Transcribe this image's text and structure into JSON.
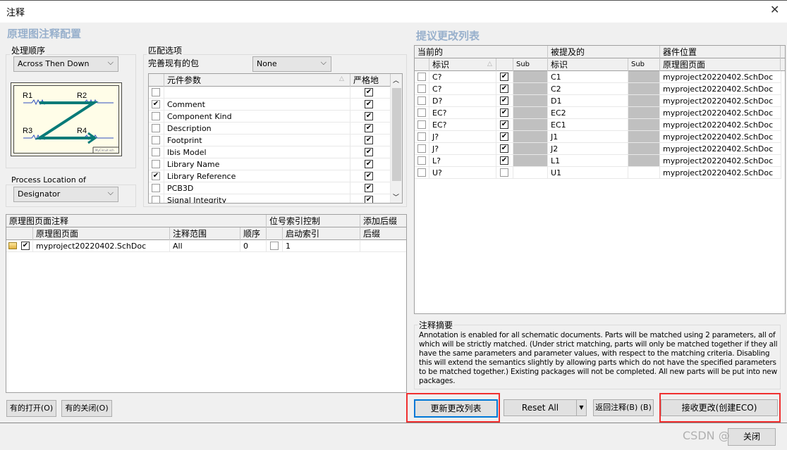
{
  "window": {
    "title": "注释",
    "close_icon": "close-icon"
  },
  "left": {
    "heading": "原理图注释配置",
    "order_group": {
      "label": "处理顺序",
      "value": "Across Then Down",
      "diagram": {
        "labels": [
          "R1",
          "R2",
          "R3",
          "R4"
        ],
        "caption": "MyCircuit.sch"
      }
    },
    "location_group": {
      "label": "Process Location of",
      "value": "Designator"
    },
    "match_group": {
      "label": "匹配选项",
      "complete_label": "完善现有的包",
      "complete_value": "None",
      "columns": {
        "param": "元件参数",
        "strict": "严格地"
      },
      "params": [
        {
          "name": "",
          "checked": false,
          "strict": true
        },
        {
          "name": "Comment",
          "checked": true,
          "strict": true
        },
        {
          "name": "Component Kind",
          "checked": false,
          "strict": true
        },
        {
          "name": "Description",
          "checked": false,
          "strict": true
        },
        {
          "name": "Footprint",
          "checked": false,
          "strict": true
        },
        {
          "name": "Ibis Model",
          "checked": false,
          "strict": true
        },
        {
          "name": "Library Name",
          "checked": false,
          "strict": true
        },
        {
          "name": "Library Reference",
          "checked": true,
          "strict": true
        },
        {
          "name": "PCB3D",
          "checked": false,
          "strict": true
        },
        {
          "name": "Signal Integrity",
          "checked": false,
          "strict": true
        }
      ]
    },
    "sheets": {
      "group1": "原理图页面注释",
      "group2": "位号索引控制",
      "group3": "添加后缀",
      "cols": {
        "page": "原理图页面",
        "scope": "注释范围",
        "order": "顺序",
        "start": "启动索引",
        "suffix": "后缀"
      },
      "rows": [
        {
          "page": "myproject20220402.SchDoc",
          "checked": true,
          "scope": "All",
          "order": "0",
          "index_checked": false,
          "start": "1",
          "suffix": ""
        }
      ]
    },
    "buttons": {
      "open_all": "有的打开(O)",
      "close_all": "有的关闭(O)"
    }
  },
  "right": {
    "heading": "提议更改列表",
    "groups": {
      "current": "当前的",
      "proposed": "被提及的",
      "location": "器件位置"
    },
    "cols": {
      "designator": "标识",
      "sub": "Sub",
      "designator2": "标识",
      "sub2": "Sub",
      "sheet": "原理图页面"
    },
    "rows": [
      {
        "current": "C?",
        "lock": true,
        "proposed": "C1",
        "sheet": "myproject20220402.SchDoc"
      },
      {
        "current": "C?",
        "lock": true,
        "proposed": "C2",
        "sheet": "myproject20220402.SchDoc"
      },
      {
        "current": "D?",
        "lock": true,
        "proposed": "D1",
        "sheet": "myproject20220402.SchDoc"
      },
      {
        "current": "EC?",
        "lock": true,
        "proposed": "EC2",
        "sheet": "myproject20220402.SchDoc"
      },
      {
        "current": "EC?",
        "lock": true,
        "proposed": "EC1",
        "sheet": "myproject20220402.SchDoc"
      },
      {
        "current": "J?",
        "lock": true,
        "proposed": "J1",
        "sheet": "myproject20220402.SchDoc"
      },
      {
        "current": "J?",
        "lock": true,
        "proposed": "J2",
        "sheet": "myproject20220402.SchDoc"
      },
      {
        "current": "L?",
        "lock": true,
        "proposed": "L1",
        "sheet": "myproject20220402.SchDoc"
      },
      {
        "current": "U?",
        "lock": false,
        "proposed": "U1",
        "sheet": "myproject20220402.SchDoc"
      }
    ],
    "summary": {
      "label": "注释摘要",
      "text": "Annotation is enabled for all schematic documents. Parts will be matched using 2 parameters, all of which will be strictly matched. (Under strict matching, parts will only be matched together if they all have the same parameters and parameter values, with respect to the matching criteria. Disabling this will extend the semantics slightly by allowing parts which do not have the specified parameters to be matched together.) Existing packages will not be completed. All new parts will be put into new packages."
    },
    "buttons": {
      "update": "更新更改列表",
      "reset": "Reset All",
      "back": "返回注释(B) (B)",
      "accept": "接收更改(创建ECO)",
      "close": "关闭"
    }
  },
  "watermark": "CSDN @",
  "colors": {
    "heading": "#98b0cc",
    "highlight": "#f03030",
    "arrow": "#087a78"
  }
}
